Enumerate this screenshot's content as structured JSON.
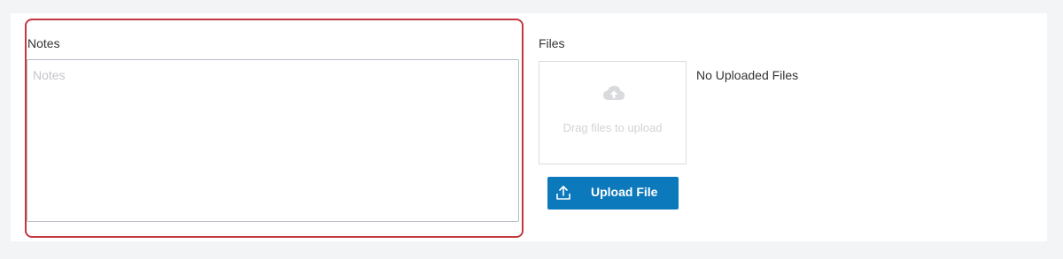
{
  "notes": {
    "label": "Notes",
    "placeholder": "Notes",
    "value": ""
  },
  "files": {
    "label": "Files",
    "dropzone_text": "Drag files to upload",
    "dropzone_icon": "cloud-upload-icon",
    "empty_text": "No Uploaded Files",
    "upload_button_label": "Upload File",
    "upload_button_icon": "upload-tray-icon"
  },
  "colors": {
    "highlight_border": "#c3383f",
    "button_bg": "#0d79bd",
    "page_bg": "#f3f4f6"
  }
}
